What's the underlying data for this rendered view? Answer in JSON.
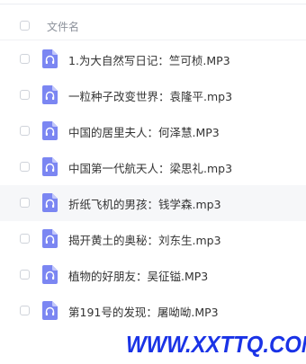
{
  "header": {
    "column_name": "文件名"
  },
  "files": [
    {
      "name": "1.为大自然写日记：竺可桢.MP3",
      "icon": "audio-file-icon"
    },
    {
      "name": "一粒种子改变世界：袁隆平.mp3",
      "icon": "audio-file-icon"
    },
    {
      "name": "中国的居里夫人：何泽慧.MP3",
      "icon": "audio-file-icon"
    },
    {
      "name": "中国第一代航天人：梁思礼.mp3",
      "icon": "audio-file-icon"
    },
    {
      "name": "折纸飞机的男孩：钱学森.mp3",
      "icon": "audio-file-icon"
    },
    {
      "name": "揭开黄土的奥秘：刘东生.mp3",
      "icon": "audio-file-icon"
    },
    {
      "name": "植物的好朋友：吴征镒.MP3",
      "icon": "audio-file-icon"
    },
    {
      "name": "第191号的发现：屠呦呦.MP3",
      "icon": "audio-file-icon"
    }
  ],
  "hovered_row": 4,
  "watermark": "WWW.XXTTQ.COM",
  "colors": {
    "icon_bg": "#7b86f2",
    "icon_fold": "#c3c8fa",
    "watermark": "#1a33e6",
    "hover": "#f6f7f9"
  }
}
